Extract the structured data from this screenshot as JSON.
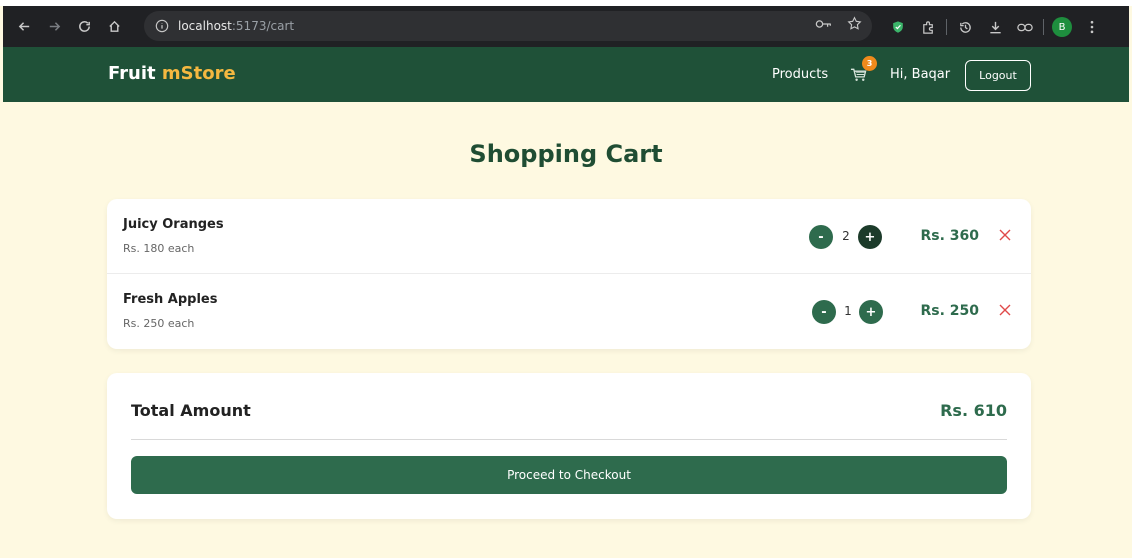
{
  "browser": {
    "url_host": "localhost",
    "url_path": ":5173/cart",
    "profile_initial": "B"
  },
  "header": {
    "brand_part1": "Fruit ",
    "brand_part2": "mStore",
    "products_label": "Products",
    "cart_count": "3",
    "greeting": "Hi, Baqar",
    "logout_label": "Logout"
  },
  "page": {
    "title": "Shopping Cart"
  },
  "cart": {
    "items": [
      {
        "name": "Juicy Oranges",
        "unit_price": "Rs. 180 each",
        "quantity": "2",
        "line_total": "Rs. 360",
        "minus": "-",
        "plus": "+"
      },
      {
        "name": "Fresh Apples",
        "unit_price": "Rs. 250 each",
        "quantity": "1",
        "line_total": "Rs. 250",
        "minus": "-",
        "plus": "+"
      }
    ]
  },
  "summary": {
    "total_label": "Total Amount",
    "total_value": "Rs. 610",
    "checkout_label": "Proceed to Checkout"
  },
  "colors": {
    "header_bg": "#1f5138",
    "page_bg": "#fef9e1",
    "brand_accent": "#f5b840",
    "primary_green": "#2e6b4d",
    "badge_orange": "#f08a1c",
    "remove_red": "#e04a4a"
  }
}
